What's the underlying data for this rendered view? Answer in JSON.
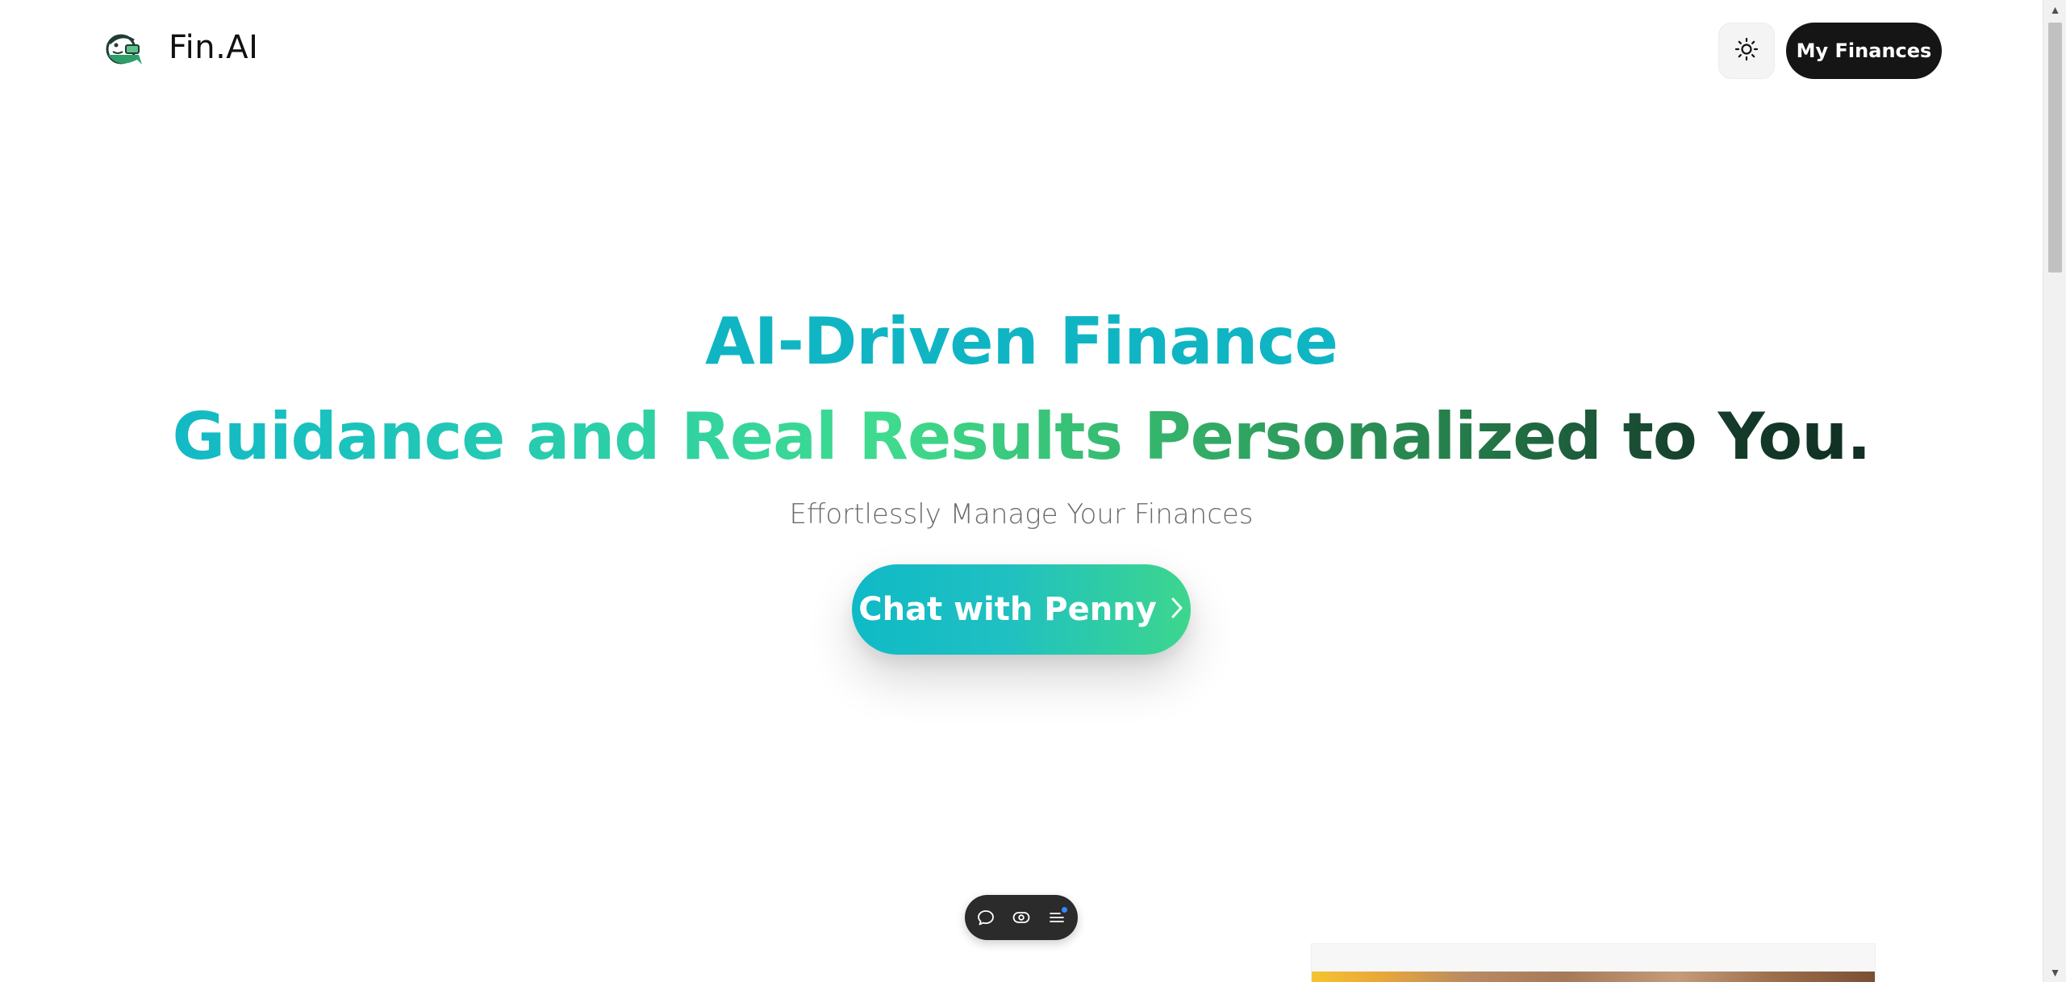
{
  "header": {
    "brand": "Fin.AI",
    "logo_icon": "fish-money-logo-icon",
    "theme_toggle_icon": "sun-icon",
    "finances_button_label": "My Finances"
  },
  "hero": {
    "title_line1": "AI-Driven Finance",
    "title_line2": "Guidance and Real Results Personalized to You.",
    "subtitle": "Effortlessly Manage Your Finances",
    "cta_label": "Chat with Penny",
    "cta_icon": "chevron-right-icon"
  },
  "toolbar": {
    "icons": [
      "chat-bubble-icon",
      "eye-icon",
      "menu-icon"
    ],
    "notification_color": "#2f8cff"
  },
  "colors": {
    "accent_teal": "#10b5c4",
    "accent_green": "#3fdb8e",
    "accent_dark_green": "#0f2f22",
    "button_dark": "#151515"
  }
}
